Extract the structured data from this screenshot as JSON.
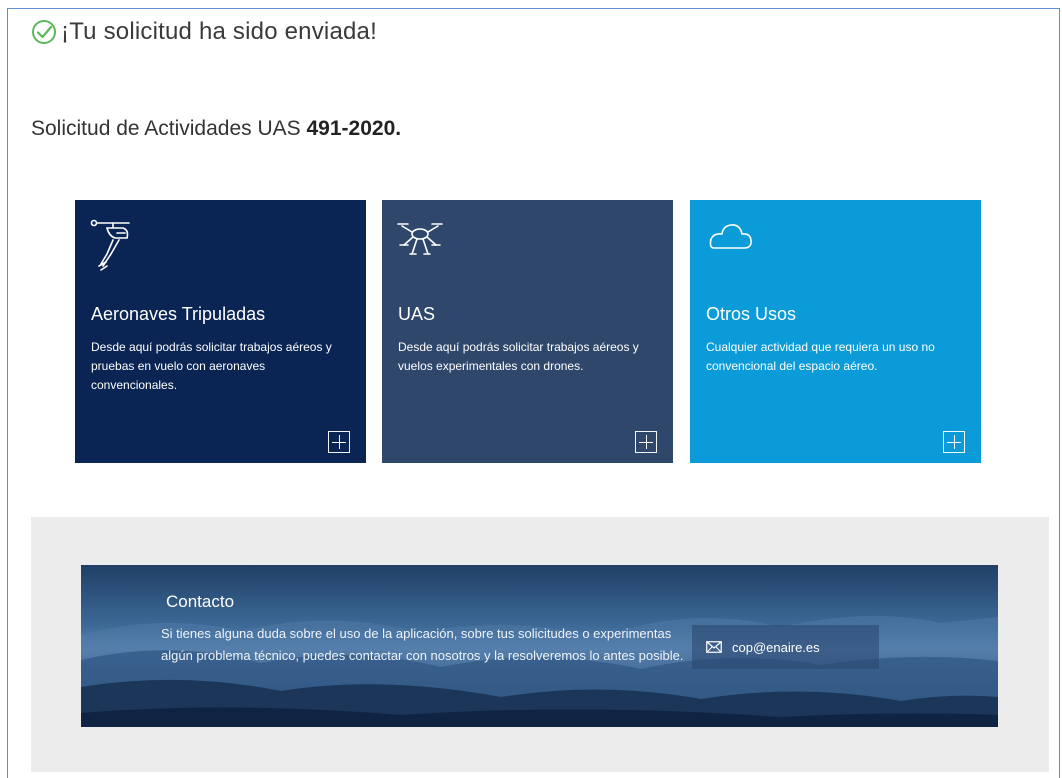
{
  "success": {
    "message": "¡Tu solicitud ha sido enviada!"
  },
  "request": {
    "label": "Solicitud de Actividades UAS",
    "number": "491-2020."
  },
  "cards": [
    {
      "title": "Aeronaves Tripuladas",
      "description": "Desde aquí podrás solicitar trabajos aéreos y pruebas en vuelo con aeronaves convencionales.",
      "icon": "helicopter-icon",
      "color": "#0a2453"
    },
    {
      "title": "UAS",
      "description": "Desde aquí podrás solicitar trabajos aéreos y vuelos experimentales con drones.",
      "icon": "drone-icon",
      "color": "#2e476b"
    },
    {
      "title": "Otros Usos",
      "description": "Cualquier actividad que requiera un uso no convencional del espacio aéreo.",
      "icon": "cloud-icon",
      "color": "#0c9bd9"
    }
  ],
  "contact": {
    "title": "Contacto",
    "text": "Si tienes alguna duda sobre el uso de la aplicación, sobre tus solicitudes o experimentas algún problema técnico, puedes contactar con nosotros y la resolveremos lo antes posible.",
    "email": "cop@enaire.es",
    "email_icon": "envelope-icon"
  },
  "colors": {
    "success_green": "#5cb85c",
    "frame_blue": "#5b8fd6"
  }
}
